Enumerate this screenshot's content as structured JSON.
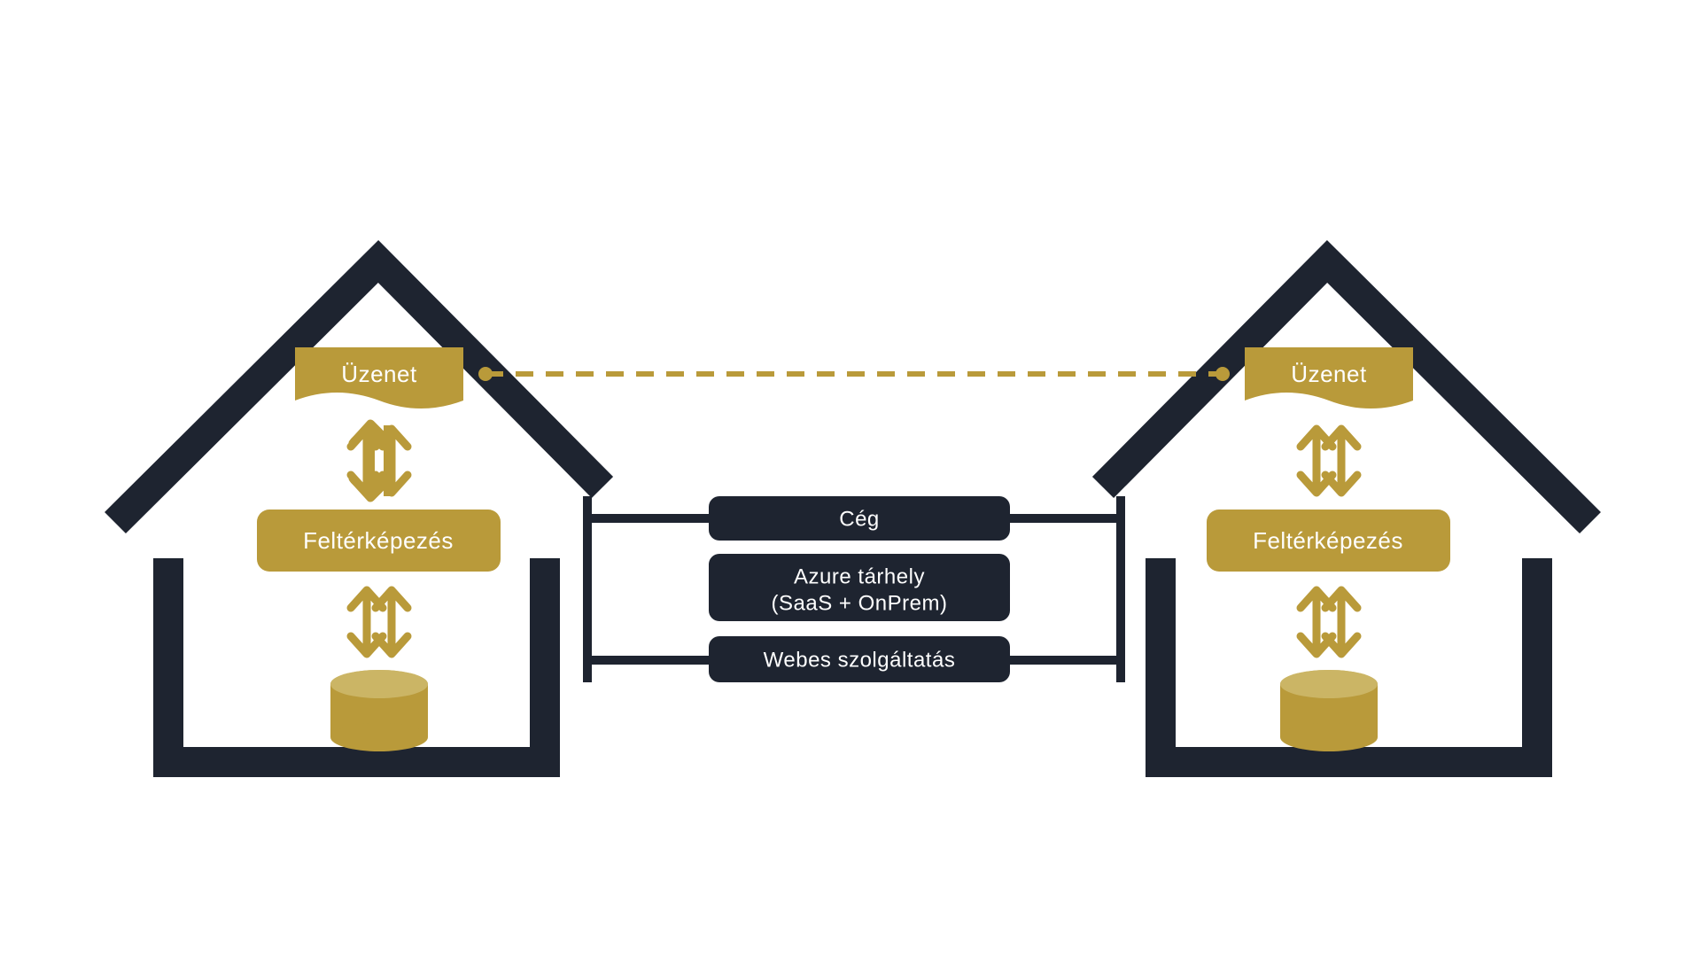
{
  "colors": {
    "dark": "#1e2430",
    "gold": "#b99a3a",
    "goldLight": "#cbb565",
    "white": "#ffffff"
  },
  "houseLeft": {
    "message": "Üzenet",
    "mapping": "Feltérképezés"
  },
  "houseRight": {
    "message": "Üzenet",
    "mapping": "Feltérképezés"
  },
  "bridge": {
    "company": "Cég",
    "hosting_line1": "Azure tárhely",
    "hosting_line2": "(SaaS + OnPrem)",
    "webservice": "Webes szolgáltatás"
  }
}
